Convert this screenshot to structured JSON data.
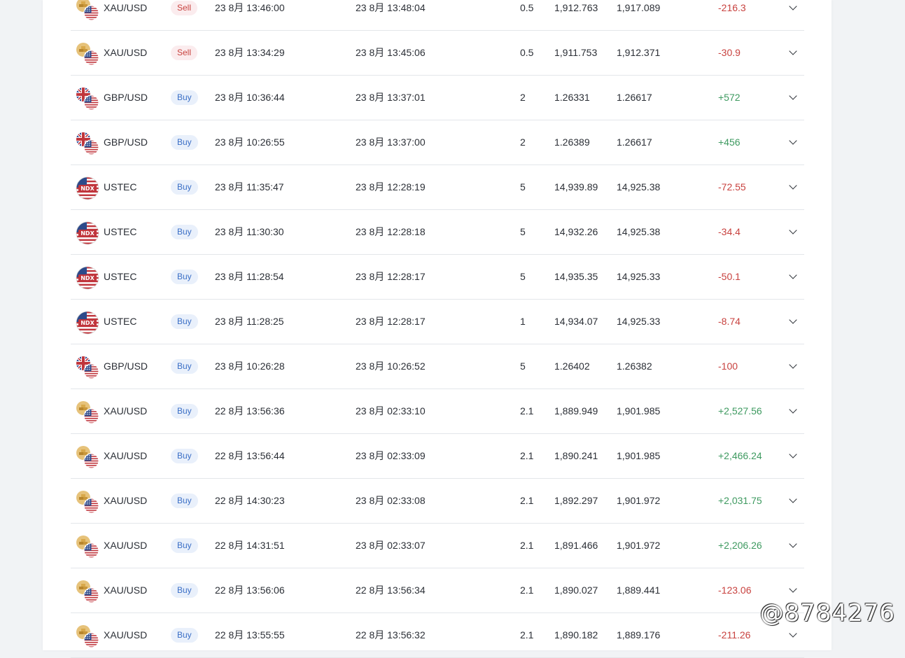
{
  "colors": {
    "buy_text": "#3b6fc6",
    "buy_bg": "#e9f0fb",
    "sell_text": "#c8423f",
    "sell_bg": "#fbecee",
    "profit": "#3e9a60",
    "loss": "#c8423f"
  },
  "watermark": "@8784276",
  "trades": [
    {
      "symbol": "XAU/USD",
      "icon": "gold-usd-icon",
      "side": "Sell",
      "open_time": "23 8月 13:46:00",
      "close_time": "23 8月 13:48:04",
      "volume": "0.5",
      "open_price": "1,912.763",
      "close_price": "1,917.089",
      "pnl": "-216.3"
    },
    {
      "symbol": "XAU/USD",
      "icon": "gold-usd-icon",
      "side": "Sell",
      "open_time": "23 8月 13:34:29",
      "close_time": "23 8月 13:45:06",
      "volume": "0.5",
      "open_price": "1,911.753",
      "close_price": "1,912.371",
      "pnl": "-30.9"
    },
    {
      "symbol": "GBP/USD",
      "icon": "gbp-usd-flag-icon",
      "side": "Buy",
      "open_time": "23 8月 10:36:44",
      "close_time": "23 8月 13:37:01",
      "volume": "2",
      "open_price": "1.26331",
      "close_price": "1.26617",
      "pnl": "+572"
    },
    {
      "symbol": "GBP/USD",
      "icon": "gbp-usd-flag-icon",
      "side": "Buy",
      "open_time": "23 8月 10:26:55",
      "close_time": "23 8月 13:37:00",
      "volume": "2",
      "open_price": "1.26389",
      "close_price": "1.26617",
      "pnl": "+456"
    },
    {
      "symbol": "USTEC",
      "icon": "ndx-us-flag-icon",
      "icon_text": "NDX",
      "side": "Buy",
      "open_time": "23 8月 11:35:47",
      "close_time": "23 8月 12:28:19",
      "volume": "5",
      "open_price": "14,939.89",
      "close_price": "14,925.38",
      "pnl": "-72.55"
    },
    {
      "symbol": "USTEC",
      "icon": "ndx-us-flag-icon",
      "icon_text": "NDX",
      "side": "Buy",
      "open_time": "23 8月 11:30:30",
      "close_time": "23 8月 12:28:18",
      "volume": "5",
      "open_price": "14,932.26",
      "close_price": "14,925.38",
      "pnl": "-34.4"
    },
    {
      "symbol": "USTEC",
      "icon": "ndx-us-flag-icon",
      "icon_text": "NDX",
      "side": "Buy",
      "open_time": "23 8月 11:28:54",
      "close_time": "23 8月 12:28:17",
      "volume": "5",
      "open_price": "14,935.35",
      "close_price": "14,925.33",
      "pnl": "-50.1"
    },
    {
      "symbol": "USTEC",
      "icon": "ndx-us-flag-icon",
      "icon_text": "NDX",
      "side": "Buy",
      "open_time": "23 8月 11:28:25",
      "close_time": "23 8月 12:28:17",
      "volume": "1",
      "open_price": "14,934.07",
      "close_price": "14,925.33",
      "pnl": "-8.74"
    },
    {
      "symbol": "GBP/USD",
      "icon": "gbp-usd-flag-icon",
      "side": "Buy",
      "open_time": "23 8月 10:26:28",
      "close_time": "23 8月 10:26:52",
      "volume": "5",
      "open_price": "1.26402",
      "close_price": "1.26382",
      "pnl": "-100"
    },
    {
      "symbol": "XAU/USD",
      "icon": "gold-usd-icon",
      "side": "Buy",
      "open_time": "22 8月 13:56:36",
      "close_time": "23 8月 02:33:10",
      "volume": "2.1",
      "open_price": "1,889.949",
      "close_price": "1,901.985",
      "pnl": "+2,527.56"
    },
    {
      "symbol": "XAU/USD",
      "icon": "gold-usd-icon",
      "side": "Buy",
      "open_time": "22 8月 13:56:44",
      "close_time": "23 8月 02:33:09",
      "volume": "2.1",
      "open_price": "1,890.241",
      "close_price": "1,901.985",
      "pnl": "+2,466.24"
    },
    {
      "symbol": "XAU/USD",
      "icon": "gold-usd-icon",
      "side": "Buy",
      "open_time": "22 8月 14:30:23",
      "close_time": "23 8月 02:33:08",
      "volume": "2.1",
      "open_price": "1,892.297",
      "close_price": "1,901.972",
      "pnl": "+2,031.75"
    },
    {
      "symbol": "XAU/USD",
      "icon": "gold-usd-icon",
      "side": "Buy",
      "open_time": "22 8月 14:31:51",
      "close_time": "23 8月 02:33:07",
      "volume": "2.1",
      "open_price": "1,891.466",
      "close_price": "1,901.972",
      "pnl": "+2,206.26"
    },
    {
      "symbol": "XAU/USD",
      "icon": "gold-usd-icon",
      "side": "Buy",
      "open_time": "22 8月 13:56:06",
      "close_time": "22 8月 13:56:34",
      "volume": "2.1",
      "open_price": "1,890.027",
      "close_price": "1,889.441",
      "pnl": "-123.06"
    },
    {
      "symbol": "XAU/USD",
      "icon": "gold-usd-icon",
      "side": "Buy",
      "open_time": "22 8月 13:55:55",
      "close_time": "22 8月 13:56:32",
      "volume": "2.1",
      "open_price": "1,890.182",
      "close_price": "1,889.176",
      "pnl": "-211.26"
    }
  ]
}
